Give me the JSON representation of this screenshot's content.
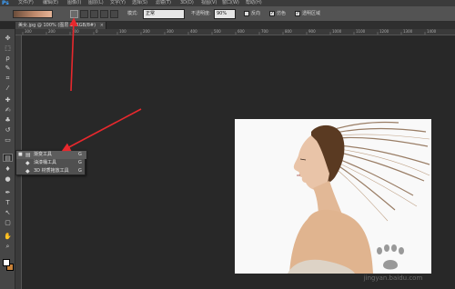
{
  "app": {
    "logo": "Ps"
  },
  "menubar": {
    "items": [
      "文件(F)",
      "编辑(E)",
      "图像(I)",
      "图层(L)",
      "文字(Y)",
      "选择(S)",
      "滤镜(T)",
      "3D(D)",
      "视图(V)",
      "窗口(W)",
      "帮助(H)"
    ]
  },
  "options": {
    "mode_label": "模式:",
    "mode_value": "正常",
    "opacity_label": "不透明度:",
    "opacity_value": "90%",
    "reverse_label": "反向",
    "dither_label": "仿色",
    "transparency_label": "透明区域",
    "gradient_start_color": "#6b4d3b",
    "gradient_end_color": "#e7b497"
  },
  "document": {
    "tab_title": "美女.jpg @ 100% (图层 1, RGB/8#)",
    "close_glyph": "×"
  },
  "ruler": {
    "labels": [
      "300",
      "200",
      "100",
      "0",
      "100",
      "200",
      "300",
      "400",
      "500",
      "600",
      "700",
      "800",
      "900",
      "1000",
      "1100",
      "1200",
      "1300",
      "1400"
    ]
  },
  "tools": [
    {
      "name": "move-tool-icon",
      "glyph": "✥"
    },
    {
      "name": "marquee-tool-icon",
      "glyph": "⬚"
    },
    {
      "name": "lasso-tool-icon",
      "glyph": "ρ"
    },
    {
      "name": "quick-select-tool-icon",
      "glyph": "✎"
    },
    {
      "name": "crop-tool-icon",
      "glyph": "⌗"
    },
    {
      "name": "eyedropper-tool-icon",
      "glyph": "⁄"
    },
    {
      "name": "healing-brush-tool-icon",
      "glyph": "✚"
    },
    {
      "name": "brush-tool-icon",
      "glyph": "✍"
    },
    {
      "name": "clone-stamp-tool-icon",
      "glyph": "♣"
    },
    {
      "name": "history-brush-tool-icon",
      "glyph": "↺"
    },
    {
      "name": "eraser-tool-icon",
      "glyph": "▭"
    },
    {
      "name": "gradient-tool-icon",
      "glyph": "▤"
    },
    {
      "name": "blur-tool-icon",
      "glyph": "♦"
    },
    {
      "name": "dodge-tool-icon",
      "glyph": "●"
    },
    {
      "name": "pen-tool-icon",
      "glyph": "✒"
    },
    {
      "name": "type-tool-icon",
      "glyph": "T"
    },
    {
      "name": "path-select-tool-icon",
      "glyph": "↖"
    },
    {
      "name": "shape-tool-icon",
      "glyph": "▢"
    },
    {
      "name": "hand-tool-icon",
      "glyph": "✋"
    },
    {
      "name": "zoom-tool-icon",
      "glyph": "⌕"
    }
  ],
  "flyout": {
    "items": [
      {
        "label": "渐变工具",
        "key": "G",
        "bullet": "■",
        "icon": "▤"
      },
      {
        "label": "油漆桶工具",
        "key": "G",
        "bullet": "",
        "icon": "◆"
      },
      {
        "label": "3D 材质拖放工具",
        "key": "G",
        "bullet": "",
        "icon": "◆"
      }
    ]
  },
  "colors": {
    "foreground": "#ffffff",
    "background": "#c8823a",
    "annotation_arrow": "#e8282d"
  },
  "watermark": {
    "text": "jingyan.baidu.com"
  }
}
